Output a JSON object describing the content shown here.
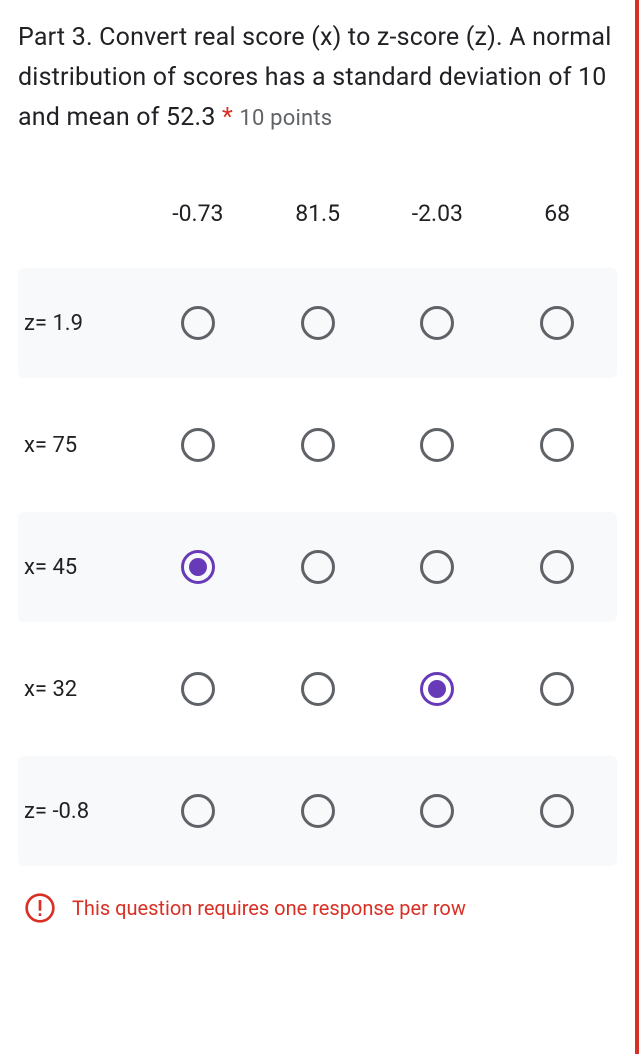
{
  "question": {
    "title": "Part 3. Convert real score (x) to z-score (z). A normal distribution of scores has a standard deviation of 10 and mean of 52.3",
    "required_mark": "*",
    "points": "10 points"
  },
  "columns": [
    "-0.73",
    "81.5",
    "-2.03",
    "68"
  ],
  "rows": [
    {
      "label": "z= 1.9",
      "selected": null,
      "hover": 3
    },
    {
      "label": "x= 75",
      "selected": null
    },
    {
      "label": "x= 45",
      "selected": 0
    },
    {
      "label": "x= 32",
      "selected": 2
    },
    {
      "label": "z= -0.8",
      "selected": null
    }
  ],
  "error": {
    "message": "This question requires one response per row"
  },
  "colors": {
    "accent": "#673ab7",
    "error": "#d93025",
    "text": "#202124",
    "muted": "#5f6368"
  }
}
